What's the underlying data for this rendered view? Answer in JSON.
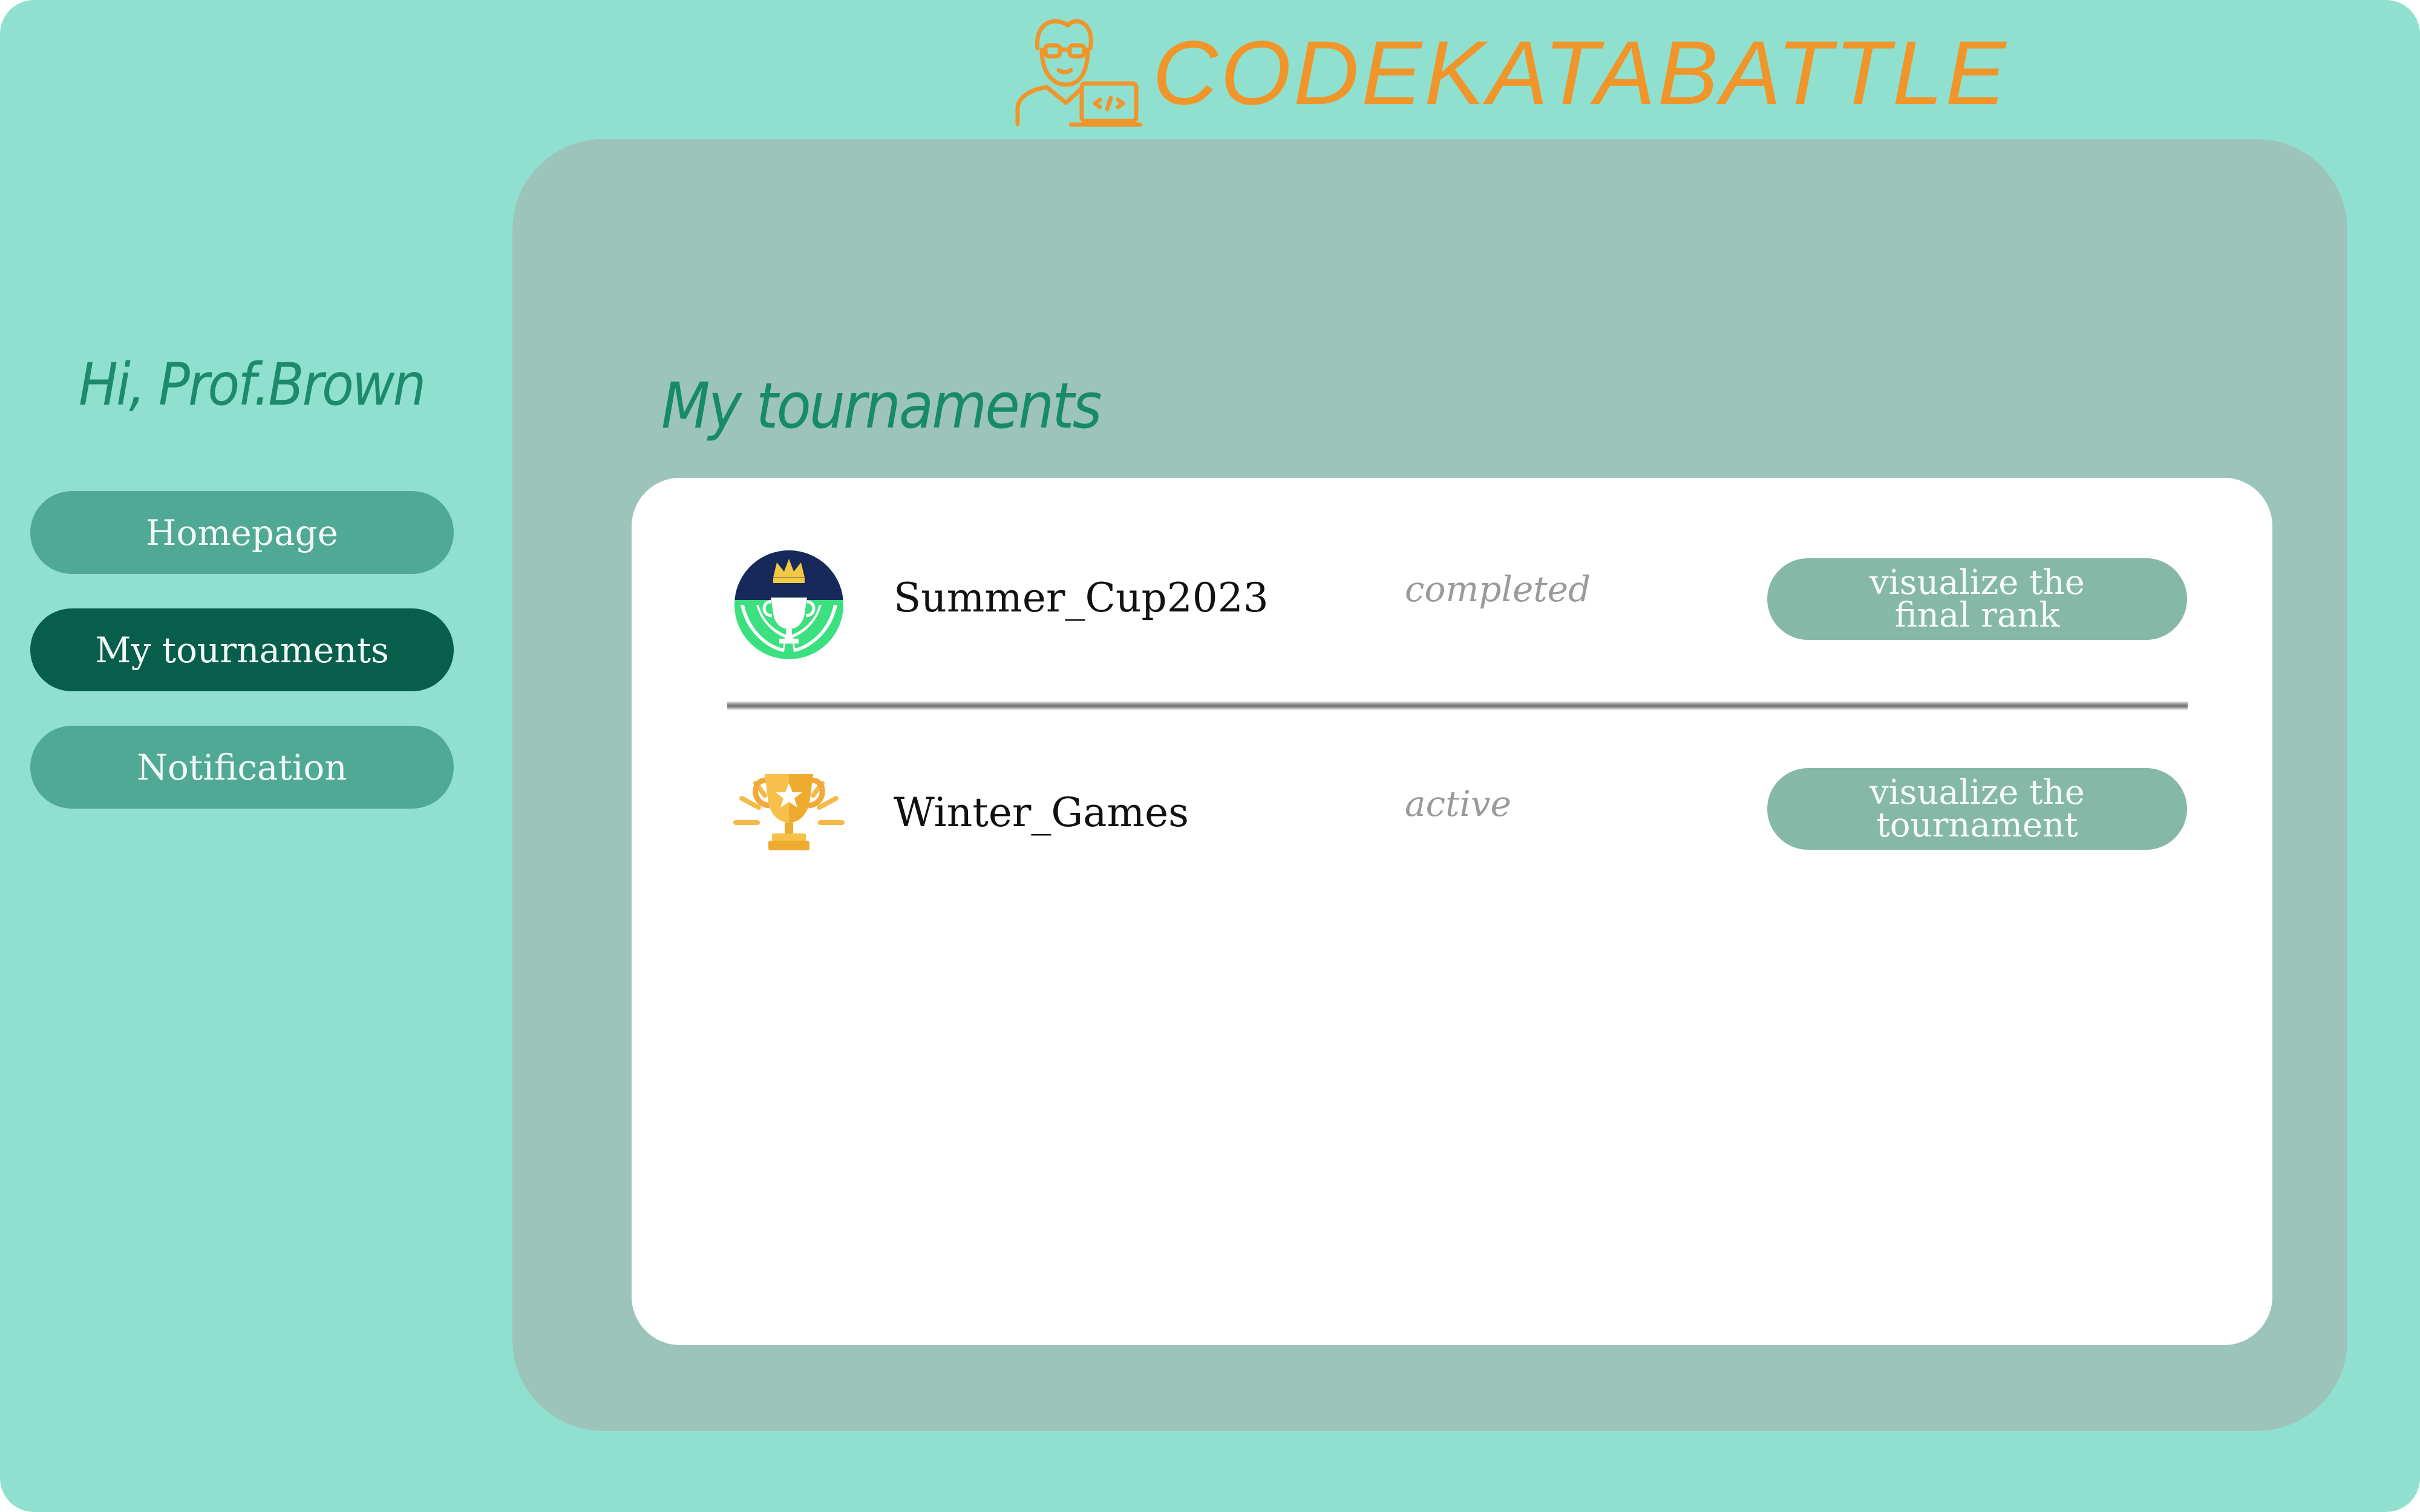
{
  "header": {
    "logo_text": "CODEKATABATTLE",
    "logo_icon": "coder-with-laptop-icon",
    "brand_color": "#f0952a"
  },
  "sidebar": {
    "greeting": "Hi, Prof.Brown",
    "items": [
      {
        "label": "Homepage",
        "active": false
      },
      {
        "label": "My tournaments",
        "active": true
      },
      {
        "label": "Notification",
        "active": false
      }
    ],
    "active_color": "#075e4a",
    "item_color": "#4fa995"
  },
  "main": {
    "title": "My tournaments",
    "tournaments": [
      {
        "name": "Summer_Cup2023",
        "status": "completed",
        "icon": "trophy-crown-badge-icon",
        "action_line1": "visualize the",
        "action_line2": "final rank"
      },
      {
        "name": "Winter_Games",
        "status": "active",
        "icon": "gold-trophy-star-icon",
        "action_line1": "visualize the",
        "action_line2": "tournament"
      }
    ]
  }
}
